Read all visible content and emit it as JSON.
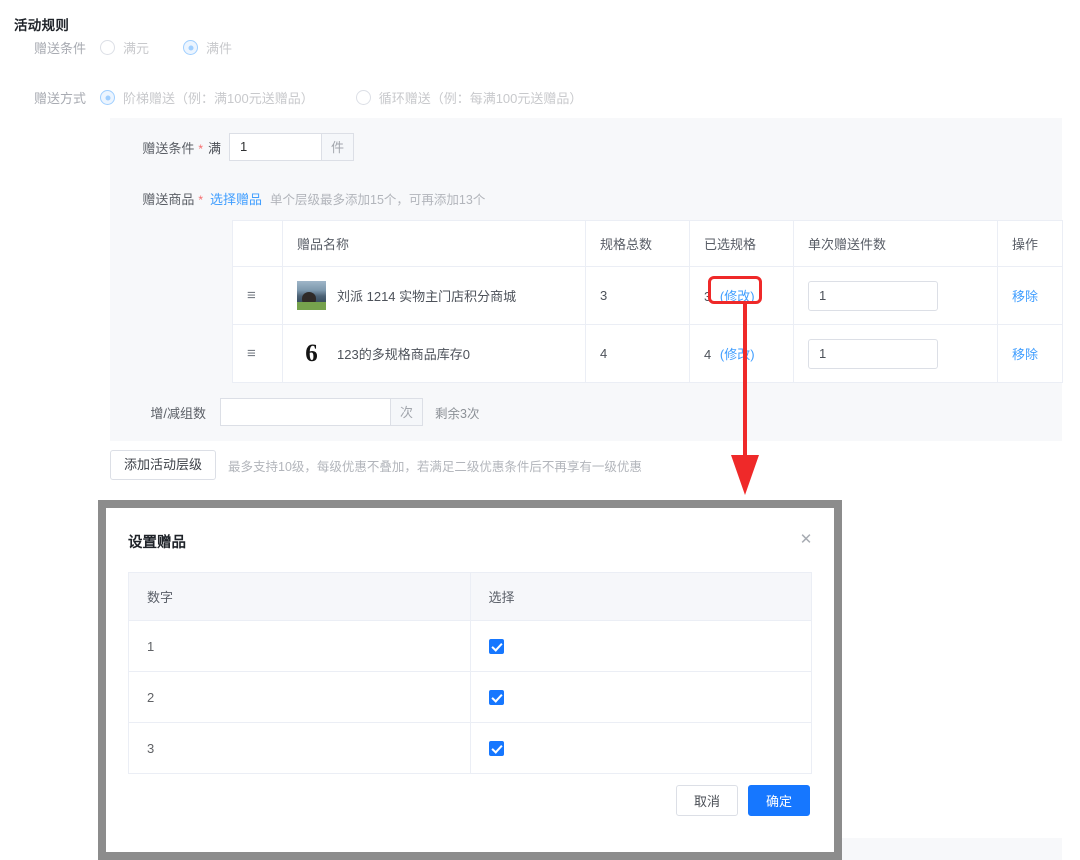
{
  "page": {
    "section_title": "活动规则"
  },
  "condition_row": {
    "label": "赠送条件",
    "options": [
      {
        "label": "满元",
        "checked": false
      },
      {
        "label": "满件",
        "checked": true
      }
    ]
  },
  "method_row": {
    "label": "赠送方式",
    "options": [
      {
        "label": "阶梯赠送（例：满100元送赠品）",
        "checked": true
      },
      {
        "label": "循环赠送（例：每满100元送赠品）",
        "checked": false
      }
    ]
  },
  "panel": {
    "gift_condition": {
      "label": "赠送条件",
      "prefix": "满",
      "value": "1",
      "unit": "件"
    },
    "gift_product": {
      "label": "赠送商品",
      "link": "选择赠品",
      "hint": "单个层级最多添加15个，可再添加13个"
    },
    "table": {
      "columns": [
        "",
        "赠品名称",
        "规格总数",
        "已选规格",
        "单次赠送件数",
        "操作"
      ],
      "rows": [
        {
          "drag": "≡",
          "thumb_kind": "photo",
          "thumb_text": "",
          "name": "刘派 1214 实物主门店积分商城",
          "spec_total": "3",
          "spec_selected": "3",
          "spec_edit": "(修改)",
          "qty": "1",
          "action": "移除"
        },
        {
          "drag": "≡",
          "thumb_kind": "glyph",
          "thumb_text": "6",
          "name": "123的多规格商品库存0",
          "spec_total": "4",
          "spec_selected": "4",
          "spec_edit": "(修改)",
          "qty": "1",
          "action": "移除"
        }
      ]
    },
    "group_count": {
      "label": "增/减组数",
      "value": "",
      "unit": "次",
      "remaining": "剩余3次"
    }
  },
  "add_level": {
    "button": "添加活动层级",
    "hint": "最多支持10级，每级优惠不叠加，若满足二级优惠条件后不再享有一级优惠"
  },
  "modal": {
    "title": "设置赠品",
    "close": "✕",
    "table": {
      "columns": [
        "数字",
        "选择"
      ],
      "rows": [
        {
          "number": "1",
          "checked": true
        },
        {
          "number": "2",
          "checked": true
        },
        {
          "number": "3",
          "checked": true
        }
      ]
    },
    "cancel": "取消",
    "confirm": "确定"
  },
  "bg_remnant": {
    "label": "增/减组数",
    "unit": "次",
    "remaining": "剩余3次"
  },
  "colors": {
    "primary": "#1677ff",
    "link": "#409eff",
    "annotation": "#ef2929",
    "panel_bg": "#f7f8fa",
    "border": "#ebeef5"
  }
}
